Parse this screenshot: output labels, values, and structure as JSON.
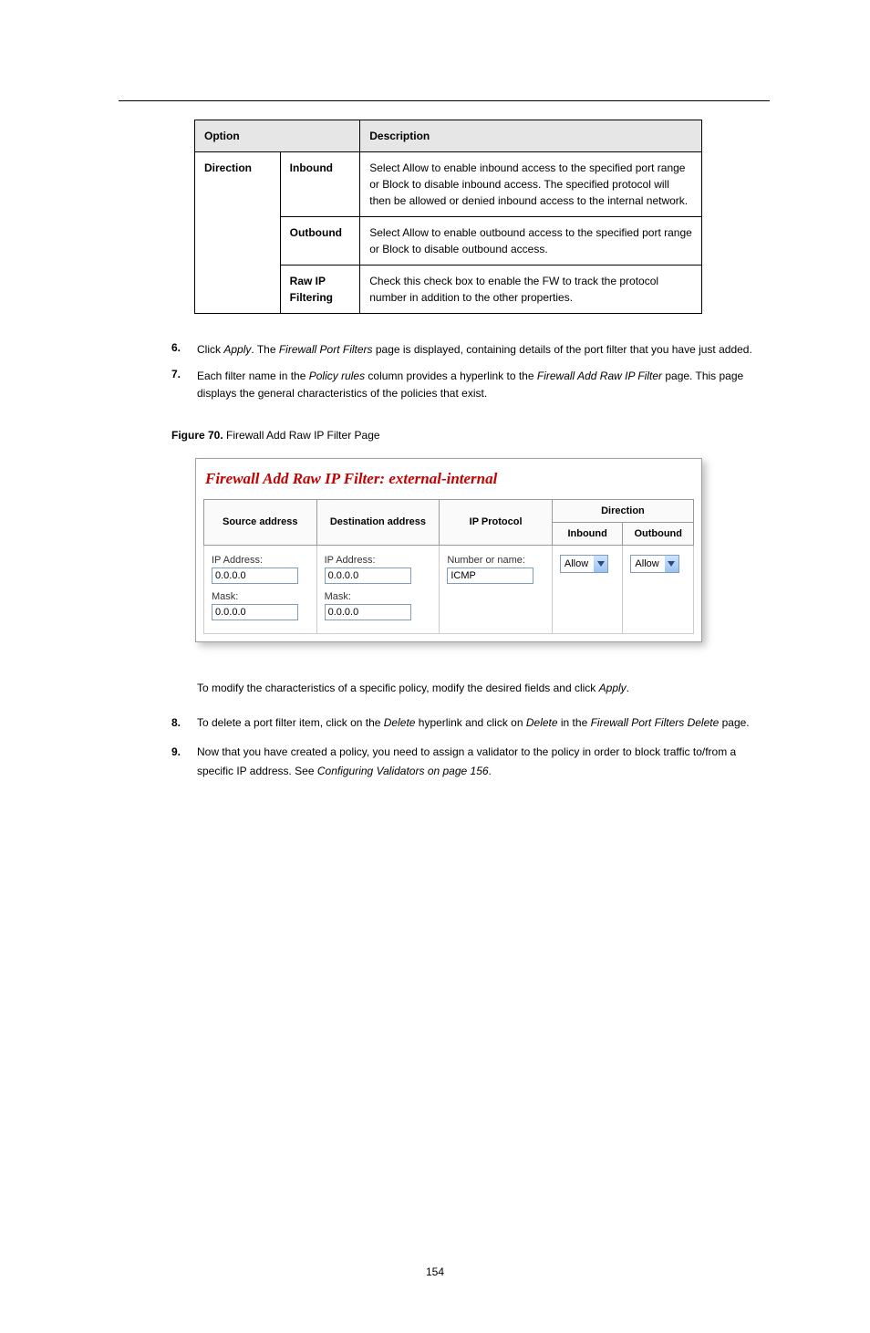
{
  "defTable": {
    "head_option": "Option",
    "head_desc": "Description",
    "r1_left": "Direction",
    "r1_sub": "Inbound",
    "r1_desc": "Select Allow to enable inbound access to the specified port range or Block to disable inbound access. The specified protocol will then be allowed or denied inbound access to the internal network.",
    "r2_sub": "Outbound",
    "r2_desc": "Select Allow to enable outbound access to the specified port range or Block to disable outbound access.",
    "r3_sub": "Raw IP Filtering",
    "r3_desc": "Check this check box to enable the FW to track the protocol number in addition to the other properties."
  },
  "bullets": {
    "n6": "6.",
    "t6_a": "Click ",
    "t6_apply": "Apply",
    "t6_b": ". The ",
    "t6_page": "Firewall Port Filters",
    "t6_c": " page is displayed, containing details of the port filter that you have just added.",
    "n7": "7.",
    "t7_a": "Each filter name in the ",
    "t7_col": "Policy rules",
    "t7_b": " column provides a hyperlink to the ",
    "t7_pg": "Firewall Add Raw IP Filter",
    "t7_c": " page. This page displays the general characteristics of the policies that exist."
  },
  "figure": {
    "id": "Figure 70.",
    "caption": "Firewall Add Raw IP Filter Page"
  },
  "screenshot": {
    "title": "Firewall Add Raw IP Filter: external-internal",
    "th_src": "Source address",
    "th_dst": "Destination address",
    "th_proto": "IP Protocol",
    "th_dir": "Direction",
    "th_in": "Inbound",
    "th_out": "Outbound",
    "lbl_ip": "IP Address:",
    "lbl_mask": "Mask:",
    "lbl_num": "Number or name:",
    "val_ip": "0.0.0.0",
    "val_mask": "0.0.0.0",
    "val_proto": "ICMP",
    "sel_allow": "Allow"
  },
  "after": {
    "intro_a": "To modify the characteristics of a specific policy, modify the desired fields and click ",
    "intro_apply": "Apply",
    "intro_b": ".",
    "n8": "8.",
    "t8_a": "To delete a port filter item, click on the ",
    "t8_del": "Delete",
    "t8_b": " hyperlink and click on ",
    "t8_hdel": "Delete",
    "t8_c": " in the ",
    "t8_pg": "Firewall Port Filters Delete",
    "t8_d": " page.",
    "n9": "9.",
    "t9_a": "Now that you have created a policy, you need to assign a validator to the policy in order to block traffic to/from a specific IP address. See ",
    "t9_link": "Configuring Validators on page 156",
    "t9_b": "."
  },
  "pageNumber": "154"
}
